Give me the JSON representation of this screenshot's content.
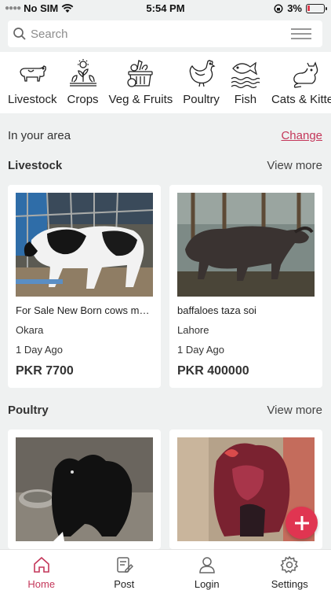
{
  "status_bar": {
    "carrier": "No SIM",
    "time": "5:54 PM",
    "battery": "3%"
  },
  "search": {
    "placeholder": "Search"
  },
  "categories": [
    {
      "label": "Livestock",
      "icon": "cow-icon"
    },
    {
      "label": "Crops",
      "icon": "crops-icon"
    },
    {
      "label": "Veg & Fruits",
      "icon": "basket-icon"
    },
    {
      "label": "Poultry",
      "icon": "rooster-icon"
    },
    {
      "label": "Fish",
      "icon": "fish-icon"
    },
    {
      "label": "Cats & Kitten",
      "icon": "cat-icon"
    }
  ],
  "area": {
    "label": "In your area",
    "change": "Change"
  },
  "sections": [
    {
      "title": "Livestock",
      "view_more": "View more",
      "listings": [
        {
          "title": "For Sale New Born cows male calf",
          "city": "Okara",
          "posted": "1 Day Ago",
          "price": "PKR 7700"
        },
        {
          "title": "baffaloes taza soi",
          "city": "Lahore",
          "posted": "1 Day Ago",
          "price": "PKR 400000"
        }
      ]
    },
    {
      "title": "Poultry",
      "view_more": "View more",
      "listings": [
        {
          "title": "",
          "city": "",
          "posted": "",
          "price": ""
        },
        {
          "title": "",
          "city": "",
          "posted": "",
          "price": ""
        }
      ]
    }
  ],
  "tabs": [
    {
      "label": "Home",
      "icon": "home-icon",
      "active": true
    },
    {
      "label": "Post",
      "icon": "post-icon",
      "active": false
    },
    {
      "label": "Login",
      "icon": "user-icon",
      "active": false
    },
    {
      "label": "Settings",
      "icon": "gear-icon",
      "active": false
    }
  ],
  "colors": {
    "accent": "#c4375a",
    "fab": "#e03551",
    "background": "#eff1f1"
  }
}
